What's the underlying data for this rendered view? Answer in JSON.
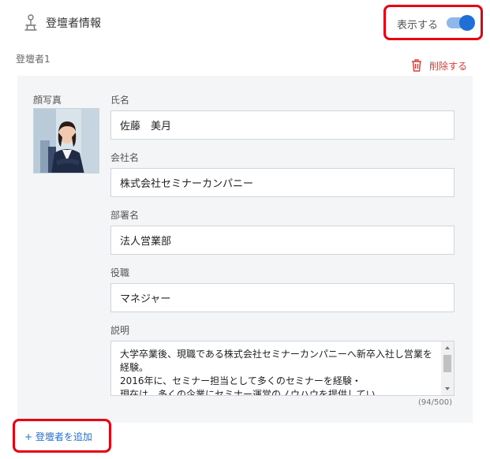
{
  "header": {
    "icon": "speaker-person-icon",
    "title": "登壇者情報",
    "toggle_label": "表示する",
    "toggle_on": true,
    "accent_color": "#1f6fd6",
    "highlight_color": "#e60012"
  },
  "speaker": {
    "label": "登壇者1",
    "delete_label": "削除する",
    "delete_icon": "trash-icon",
    "photo_label": "顔写真",
    "fields": {
      "name_label": "氏名",
      "name_value": "佐藤　美月",
      "company_label": "会社名",
      "company_value": "株式会社セミナーカンパニー",
      "department_label": "部署名",
      "department_value": "法人営業部",
      "title_label": "役職",
      "title_value": "マネジャー",
      "description_label": "説明",
      "description_value": "大学卒業後、現職である株式会社セミナーカンパニーへ新卒入社し営業を経験。\n2016年に、セミナー担当として多くのセミナーを経験・\n現在は、多くの企業にセミナー運営のノウハウを提供してい",
      "char_count": "(94/500)"
    }
  },
  "footer": {
    "add_label": "+ 登壇者を追加"
  }
}
